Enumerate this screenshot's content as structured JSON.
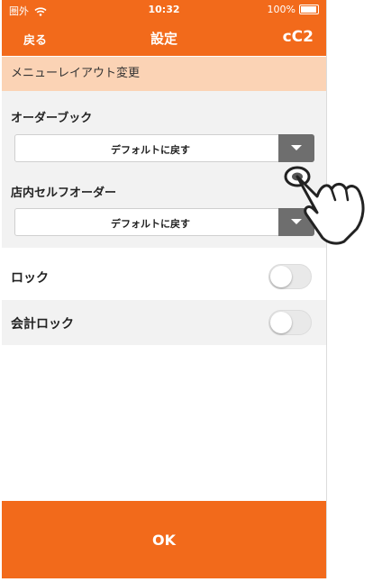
{
  "status_bar": {
    "carrier": "圏外",
    "time": "10:32",
    "battery": "100%"
  },
  "nav": {
    "back_label": "戻る",
    "title": "設定",
    "logo_text": "cC2"
  },
  "section": {
    "header": "メニューレイアウト変更"
  },
  "order_book": {
    "label": "オーダーブック",
    "value": "デフォルトに戻す"
  },
  "self_order": {
    "label": "店内セルフオーダー",
    "value": "デフォルトに戻す"
  },
  "lock": {
    "label": "ロック",
    "enabled": false
  },
  "accounting_lock": {
    "label": "会計ロック",
    "enabled": false
  },
  "footer": {
    "ok_label": "OK"
  },
  "colors": {
    "accent": "#f26a1b",
    "section_bg": "#fbd3b5",
    "gray_bg": "#f2f2f2"
  },
  "icons": [
    "wifi-icon",
    "battery-icon",
    "dropdown-arrow-icon",
    "pointing-hand-icon"
  ]
}
